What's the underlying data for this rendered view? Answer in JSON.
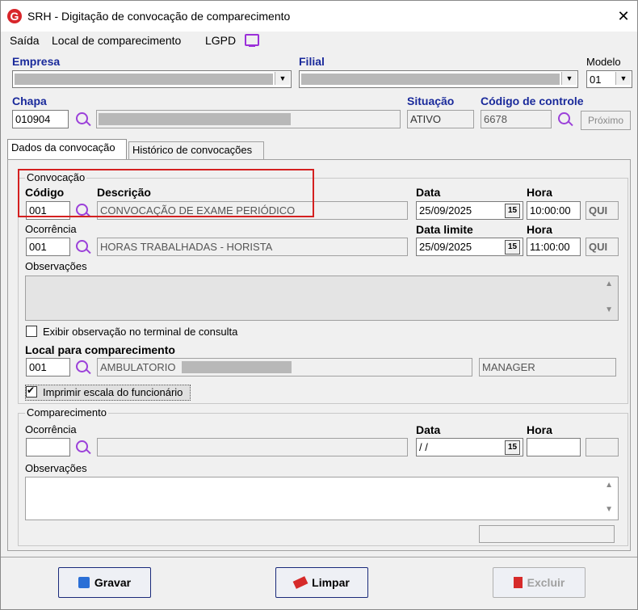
{
  "window": {
    "title": "SRH - Digitação de convocação de comparecimento",
    "close": "✕"
  },
  "menu": {
    "items": [
      "Saída",
      "Local de comparecimento",
      "LGPD"
    ]
  },
  "header": {
    "empresa_label": "Empresa",
    "filial_label": "Filial",
    "modelo_label": "Modelo",
    "modelo_value": "01",
    "chapa_label": "Chapa",
    "chapa_value": "010904",
    "situacao_label": "Situação",
    "situacao_value": "ATIVO",
    "codigo_controle_label": "Código de controle",
    "codigo_controle_value": "6678",
    "proximo_button": "Próximo"
  },
  "tabs": [
    "Dados da convocação",
    "Histórico de convocações"
  ],
  "convocacao": {
    "group_title": "Convocação",
    "codigo_label": "Código",
    "codigo_value": "001",
    "descricao_label": "Descrição",
    "descricao_value": "CONVOCAÇÃO DE EXAME PERIÓDICO",
    "data_label": "Data",
    "data_value": "25/09/2025",
    "hora_label": "Hora",
    "hora_value": "10:00:00",
    "dia_value": "QUI",
    "ocorrencia_label": "Ocorrência",
    "ocorrencia_value": "001",
    "ocorrencia_desc": "HORAS TRABALHADAS - HORISTA",
    "data_limite_label": "Data limite",
    "data_limite_value": "25/09/2025",
    "hora2_label": "Hora",
    "hora2_value": "11:00:00",
    "dia2_value": "QUI",
    "observacoes_label": "Observações",
    "exibir_obs_label": "Exibir observação no terminal de consulta",
    "local_label": "Local para comparecimento",
    "local_codigo": "001",
    "local_desc": "AMBULATORIO",
    "local_user": "MANAGER",
    "imprimir_label": "Imprimir escala do funcionário",
    "calendar_glyph": "15"
  },
  "comparecimento": {
    "group_title": "Comparecimento",
    "ocorrencia_label": "Ocorrência",
    "data_label": "Data",
    "data_value": " / /",
    "hora_label": "Hora",
    "observacoes_label": "Observações"
  },
  "footer": {
    "gravar": "Gravar",
    "limpar": "Limpar",
    "excluir": "Excluir"
  },
  "colors": {
    "label_blue": "#1a2a9b",
    "highlight_red": "#d42020",
    "icon_purple": "#9b40d9"
  }
}
